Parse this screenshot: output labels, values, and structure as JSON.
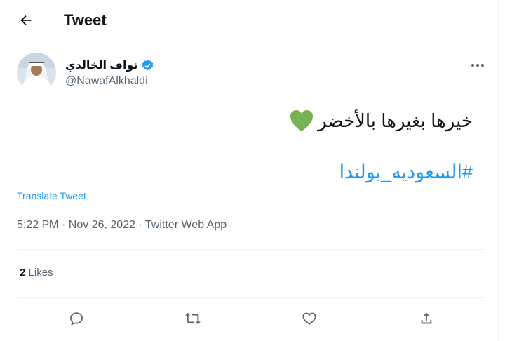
{
  "header": {
    "title": "Tweet"
  },
  "author": {
    "display_name": "نواف الخالدي",
    "handle": "@NawafAlkhaldi"
  },
  "tweet": {
    "line1": "خيرها بغيرها بالأخضر",
    "emoji": "💚",
    "hashtag": "#السعوديه_بولندا"
  },
  "translate_label": "Translate Tweet",
  "meta": "5:22 PM · Nov 26, 2022 · Twitter Web App",
  "stats": {
    "likes_count": "2",
    "likes_label": "Likes"
  },
  "colors": {
    "accent": "#1d9bf0",
    "text": "#0f1419",
    "muted": "#536471",
    "heart": "#77b255"
  },
  "icons": [
    "back-arrow-icon",
    "verified-badge-icon",
    "more-icon",
    "reply-icon",
    "retweet-icon",
    "like-icon",
    "share-icon"
  ]
}
